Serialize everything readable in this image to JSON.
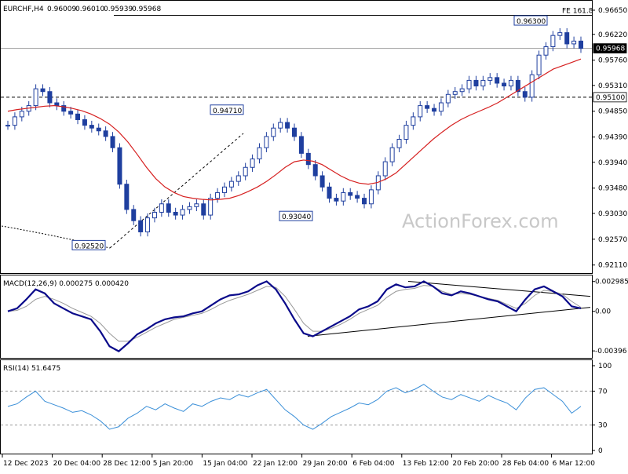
{
  "header": {
    "symbol": "EURCHF,H4",
    "ohlc": [
      "0.96009",
      "0.96010",
      "0.95939",
      "0.95968"
    ]
  },
  "watermark": "ActionForex.com",
  "colors": {
    "background": "#ffffff",
    "candle": "#1f3f9f",
    "ma": "#d62020",
    "macd_line": "#0a0a8a",
    "macd_signal": "#999999",
    "rsi_line": "#3a8fd8",
    "guide": "#999999",
    "trendline": "#000000",
    "watermark": "#c8c8c8"
  },
  "chart_data": [
    {
      "type": "line",
      "panel": "price",
      "title": "EURCHF,H4",
      "yaxis_ticks": [
        "0.96650",
        "0.96220",
        "0.95760",
        "0.95310",
        "0.94850",
        "0.94390",
        "0.93940",
        "0.93480",
        "0.93030",
        "0.92570",
        "0.92110"
      ],
      "ylim": [
        0.9205,
        0.9672
      ],
      "price_label": "0.95968",
      "levels": [
        {
          "label": "0.95100",
          "value": 0.951
        },
        {
          "label": "FE 161.8",
          "value": 0.9656
        }
      ],
      "annotations": [
        {
          "text": "0.92520",
          "x": "28 Dec 2023",
          "y": 0.9252
        },
        {
          "text": "0.94710",
          "x": "17 Jan 2024",
          "y": 0.9471
        },
        {
          "text": "0.93040",
          "x": "31 Jan 2024",
          "y": 0.9304
        },
        {
          "text": "0.96300",
          "x": "4 Mar 2024",
          "y": 0.963
        }
      ],
      "xaxis_labels": [
        "12 Dec 2023",
        "20 Dec 04:00",
        "28 Dec 12:00",
        "5 Jan 20:00",
        "15 Jan 04:00",
        "22 Jan 12:00",
        "29 Jan 20:00",
        "6 Feb 04:00",
        "13 Feb 12:00",
        "20 Feb 20:00",
        "28 Feb 04:00",
        "6 Mar 12:00"
      ],
      "series": [
        {
          "kind": "close",
          "values": [
            0.946,
            0.9475,
            0.9485,
            0.9495,
            0.9525,
            0.952,
            0.95,
            0.9495,
            0.9485,
            0.948,
            0.947,
            0.946,
            0.9455,
            0.945,
            0.944,
            0.942,
            0.9355,
            0.931,
            0.929,
            0.927,
            0.9295,
            0.9305,
            0.932,
            0.9305,
            0.93,
            0.931,
            0.9315,
            0.932,
            0.93,
            0.933,
            0.934,
            0.935,
            0.936,
            0.937,
            0.9385,
            0.94,
            0.942,
            0.944,
            0.9455,
            0.9465,
            0.9455,
            0.944,
            0.941,
            0.939,
            0.937,
            0.935,
            0.933,
            0.9325,
            0.934,
            0.9335,
            0.933,
            0.932,
            0.9345,
            0.937,
            0.9395,
            0.942,
            0.9435,
            0.946,
            0.9475,
            0.9495,
            0.949,
            0.9485,
            0.95,
            0.9515,
            0.952,
            0.9525,
            0.954,
            0.953,
            0.954,
            0.9545,
            0.9535,
            0.953,
            0.954,
            0.952,
            0.951,
            0.955,
            0.9585,
            0.96,
            0.962,
            0.9625,
            0.9605,
            0.961,
            0.9597
          ]
        },
        {
          "kind": "moving average",
          "values": [
            0.9485,
            0.9488,
            0.949,
            0.9492,
            0.9494,
            0.9495,
            0.9493,
            0.949,
            0.9486,
            0.948,
            0.9472,
            0.9462,
            0.9448,
            0.943,
            0.9408,
            0.9385,
            0.9365,
            0.935,
            0.934,
            0.9333,
            0.933,
            0.9328,
            0.9327,
            0.9328,
            0.933,
            0.9335,
            0.9342,
            0.935,
            0.936,
            0.9372,
            0.9385,
            0.9395,
            0.9398,
            0.9396,
            0.939,
            0.938,
            0.937,
            0.9362,
            0.9357,
            0.9355,
            0.9358,
            0.9365,
            0.9375,
            0.939,
            0.9405,
            0.942,
            0.9435,
            0.9448,
            0.946,
            0.947,
            0.9478,
            0.9485,
            0.9492,
            0.95,
            0.951,
            0.952,
            0.953,
            0.954,
            0.955,
            0.956,
            0.9566,
            0.9572,
            0.9578
          ]
        }
      ]
    },
    {
      "type": "line",
      "panel": "indicator",
      "title": "MACD(12,26,9) 0.000275 0.000420",
      "yaxis_ticks": [
        "0.002985",
        "0.00",
        "-0.00396"
      ],
      "ylim": [
        -0.0045,
        0.0032
      ],
      "series": [
        {
          "kind": "macd",
          "values": [
            0.0,
            0.0003,
            0.0012,
            0.0022,
            0.0018,
            0.0008,
            0.0003,
            -0.0002,
            -0.0005,
            -0.0008,
            -0.002,
            -0.0035,
            -0.004,
            -0.0032,
            -0.0023,
            -0.0018,
            -0.0012,
            -0.0008,
            -0.0006,
            -0.0005,
            -0.0002,
            0.0,
            0.0006,
            0.0012,
            0.0016,
            0.0017,
            0.002,
            0.0026,
            0.003,
            0.0022,
            0.0008,
            -0.0008,
            -0.0022,
            -0.0025,
            -0.002,
            -0.0015,
            -0.001,
            -0.0005,
            0.0002,
            0.0005,
            0.001,
            0.0022,
            0.0027,
            0.0024,
            0.0025,
            0.003,
            0.0025,
            0.0018,
            0.0016,
            0.002,
            0.0018,
            0.0015,
            0.0012,
            0.001,
            0.0005,
            0.0,
            0.0012,
            0.0022,
            0.0025,
            0.002,
            0.0015,
            0.0005,
            0.0003
          ]
        },
        {
          "kind": "signal",
          "values": [
            0.0,
            0.0001,
            0.0005,
            0.0012,
            0.0015,
            0.0012,
            0.0008,
            0.0003,
            -0.0001,
            -0.0005,
            -0.0012,
            -0.0022,
            -0.003,
            -0.003,
            -0.0026,
            -0.0021,
            -0.0016,
            -0.0012,
            -0.0008,
            -0.0006,
            -0.0004,
            -0.0002,
            0.0002,
            0.0007,
            0.0011,
            0.0014,
            0.0017,
            0.0021,
            0.0025,
            0.0024,
            0.0015,
            0.0002,
            -0.0012,
            -0.002,
            -0.002,
            -0.0017,
            -0.0013,
            -0.0008,
            -0.0002,
            0.0002,
            0.0006,
            0.0014,
            0.002,
            0.0022,
            0.0023,
            0.0026,
            0.0025,
            0.002,
            0.0017,
            0.0018,
            0.0017,
            0.0015,
            0.0013,
            0.0011,
            0.0007,
            0.0003,
            0.0008,
            0.0016,
            0.0021,
            0.002,
            0.0017,
            0.001,
            0.0004
          ]
        }
      ]
    },
    {
      "type": "line",
      "panel": "indicator",
      "title": "RSI(14) 51.6475",
      "yaxis_ticks": [
        "100",
        "70",
        "30",
        "0"
      ],
      "ylim": [
        0,
        100
      ],
      "levels": [
        70,
        30
      ],
      "series": [
        {
          "kind": "rsi",
          "values": [
            52,
            55,
            63,
            70,
            58,
            54,
            50,
            45,
            47,
            42,
            35,
            25,
            28,
            38,
            44,
            52,
            48,
            55,
            50,
            46,
            55,
            52,
            58,
            62,
            60,
            66,
            63,
            68,
            72,
            60,
            48,
            40,
            30,
            25,
            32,
            40,
            45,
            50,
            56,
            54,
            60,
            70,
            74,
            68,
            72,
            78,
            70,
            63,
            60,
            66,
            62,
            58,
            65,
            60,
            56,
            48,
            62,
            72,
            74,
            66,
            58,
            44,
            52
          ]
        }
      ]
    }
  ]
}
